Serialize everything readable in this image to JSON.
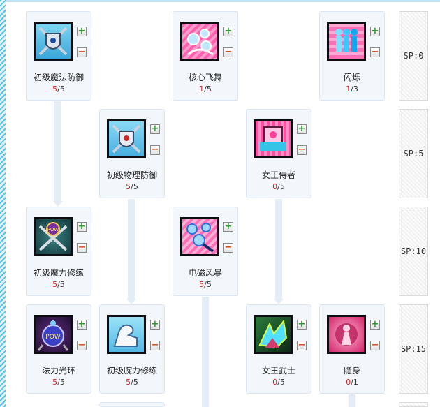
{
  "sp_column": [
    "SP:0",
    "SP:5",
    "SP:10",
    "SP:15"
  ],
  "skills": {
    "basic_magic_defense": {
      "name": "初级魔法防御",
      "current": "5",
      "max": "5",
      "icon": "shield-crossed-swords-icon"
    },
    "core_flying_dance": {
      "name": "核心飞舞",
      "current": "1",
      "max": "5",
      "icon": "swirling-orbs-icon"
    },
    "flash": {
      "name": "闪烁",
      "current": "1",
      "max": "3",
      "icon": "afterimage-figure-icon"
    },
    "basic_physical_defense": {
      "name": "初级物理防御",
      "current": "5",
      "max": "5",
      "icon": "shield-crossed-swords-icon"
    },
    "queen_attendant": {
      "name": "女王侍者",
      "current": "0",
      "max": "5",
      "icon": "pink-throne-icon"
    },
    "basic_magic_training": {
      "name": "初级魔力修练",
      "current": "5",
      "max": "5",
      "icon": "pow-crossed-swords-icon"
    },
    "electromagnetic_storm": {
      "name": "电磁风暴",
      "current": "5",
      "max": "5",
      "icon": "electric-orbs-icon"
    },
    "mana_aura": {
      "name": "法力光环",
      "current": "5",
      "max": "5",
      "icon": "pow-orb-icon"
    },
    "basic_arm_training": {
      "name": "初级腕力修练",
      "current": "5",
      "max": "5",
      "icon": "flexed-arm-icon"
    },
    "queen_warrior": {
      "name": "女王武士",
      "current": "0",
      "max": "5",
      "icon": "queen-warrior-icon"
    },
    "stealth": {
      "name": "隐身",
      "current": "0",
      "max": "1",
      "icon": "hidden-figure-icon"
    }
  },
  "buttons": {
    "plus": "+",
    "minus": "−"
  },
  "separator": "/",
  "colors": {
    "level_current": "#d22222",
    "card_bg": "#f3f7fc",
    "connector": "#e4ecf6"
  }
}
